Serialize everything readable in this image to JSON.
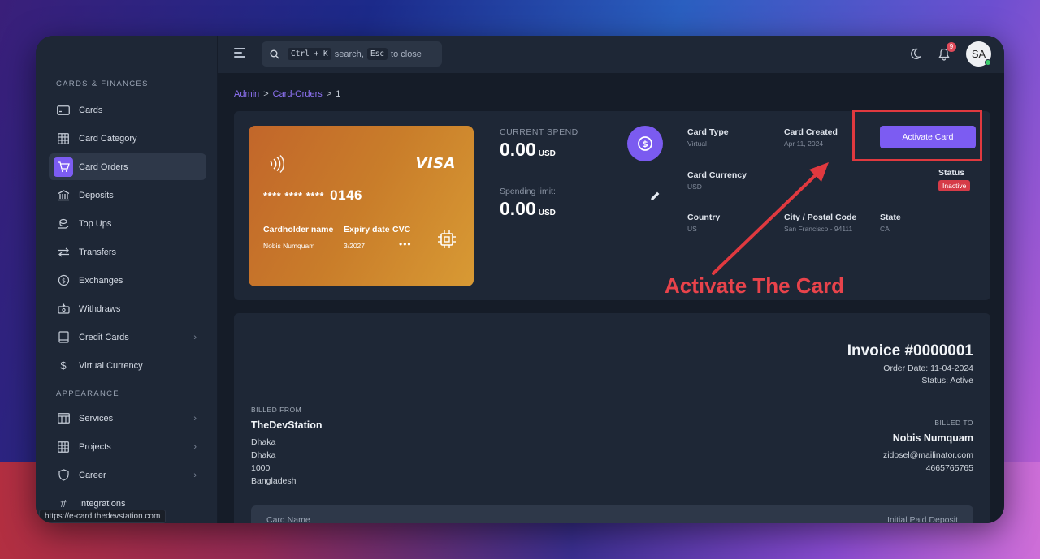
{
  "topbar": {
    "search_kbd1": "Ctrl + K",
    "search_text1": "search,",
    "search_kbd2": "Esc",
    "search_text2": "to close",
    "notification_count": "9",
    "avatar_initials": "SA"
  },
  "sidebar": {
    "section1": "CARDS & FINANCES",
    "items1": [
      {
        "label": "Cards",
        "icon": "credit-card-icon"
      },
      {
        "label": "Card Category",
        "icon": "grid-icon"
      },
      {
        "label": "Card Orders",
        "icon": "shopping-cart-icon",
        "active": true
      },
      {
        "label": "Deposits",
        "icon": "bank-icon"
      },
      {
        "label": "Top Ups",
        "icon": "coins-icon"
      },
      {
        "label": "Transfers",
        "icon": "arrows-icon"
      },
      {
        "label": "Exchanges",
        "icon": "exchange-icon"
      },
      {
        "label": "Withdraws",
        "icon": "withdraw-icon"
      },
      {
        "label": "Credit Cards",
        "icon": "book-icon",
        "has_chevron": true
      },
      {
        "label": "Virtual Currency",
        "icon": "dollar-icon"
      }
    ],
    "section2": "APPEARANCE",
    "items2": [
      {
        "label": "Services",
        "icon": "table-icon",
        "has_chevron": true
      },
      {
        "label": "Projects",
        "icon": "grid-icon",
        "has_chevron": true
      },
      {
        "label": "Career",
        "icon": "shield-icon",
        "has_chevron": true
      },
      {
        "label": "Integrations",
        "icon": "hash-icon"
      }
    ],
    "status_url": "https://e-card.thedevstation.com"
  },
  "breadcrumb": {
    "admin": "Admin",
    "card_orders": "Card-Orders",
    "current": "1",
    "sep": ">"
  },
  "card": {
    "brand": "VISA",
    "masked": "**** **** ****",
    "last4": "0146",
    "holder_label": "Cardholder name",
    "holder_value": "Nobis Numquam",
    "expiry_label": "Expiry date",
    "expiry_value": "3/2027",
    "cvc_label": "CVC",
    "cvc_value": "•••"
  },
  "spend": {
    "current_label": "CURRENT SPEND",
    "current_value": "0.00",
    "current_currency": "USD",
    "limit_label": "Spending limit:",
    "limit_value": "0.00",
    "limit_currency": "USD"
  },
  "info": {
    "card_type_label": "Card Type",
    "card_type_value": "Virtual",
    "card_created_label": "Card Created",
    "card_created_value": "Apr 11, 2024",
    "card_currency_label": "Card Currency",
    "card_currency_value": "USD",
    "status_label": "Status",
    "status_value": "Inactive",
    "country_label": "Country",
    "country_value": "US",
    "city_label": "City / Postal Code",
    "city_value": "San Francisco - 94111",
    "state_label": "State",
    "state_value": "CA",
    "activate_button": "Activate Card"
  },
  "annotation": "Activate The Card",
  "invoice": {
    "title": "Invoice #0000001",
    "order_date": "Order Date: 11-04-2024",
    "status": "Status: Active",
    "billed_from_label": "BILLED FROM",
    "billed_from_name": "TheDevStation",
    "billed_from_lines": [
      "Dhaka",
      "Dhaka",
      "1000",
      "Bangladesh"
    ],
    "billed_to_label": "BILLED TO",
    "billed_to_name": "Nobis Numquam",
    "billed_to_lines": [
      "zidosel@mailinator.com",
      "4665765765"
    ],
    "table_col1": "Card Name",
    "table_col2": "Initial Paid Deposit"
  },
  "colors": {
    "accent": "#7c5cf2",
    "danger": "#e0393f",
    "card_gradient_start": "#c2662a",
    "card_gradient_end": "#d89a34"
  }
}
